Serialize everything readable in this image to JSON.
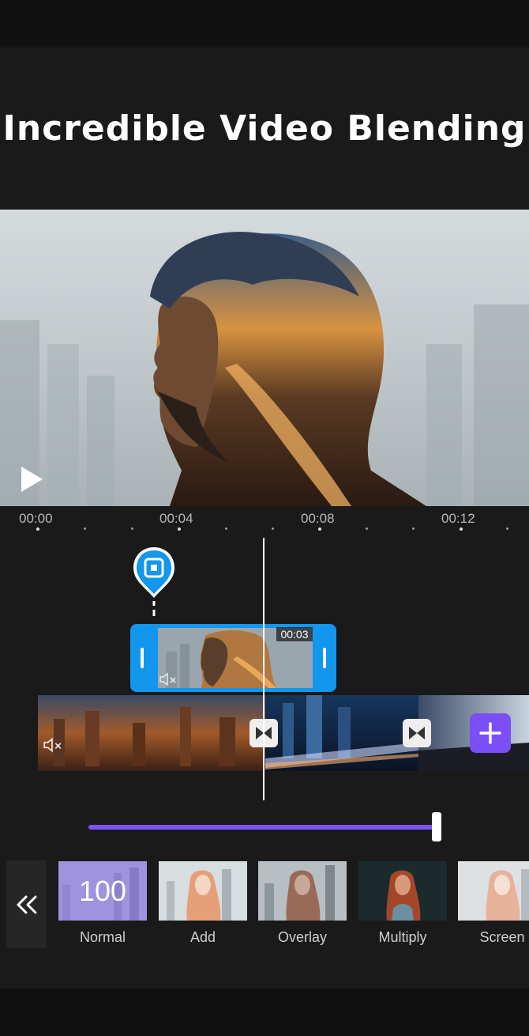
{
  "headline": "Incredible Video Blending",
  "timeline": {
    "ticks": [
      "00:00",
      "00:04",
      "00:08",
      "00:12"
    ],
    "overlay_duration": "00:03"
  },
  "blend_panel": {
    "opacity_value": "100",
    "opacity_level": 1.0,
    "modes": [
      "Normal",
      "Add",
      "Overlay",
      "Multiply",
      "Screen"
    ],
    "selected": "Normal"
  },
  "colors": {
    "background": "#1a1a1a",
    "overlay_clip": "#1296ee",
    "accent_purple": "#7b4ff5"
  },
  "icons": [
    "play-icon",
    "overlay-marker-icon",
    "mute-icon",
    "transition-icon",
    "plus-icon",
    "double-chevron-left-icon"
  ]
}
